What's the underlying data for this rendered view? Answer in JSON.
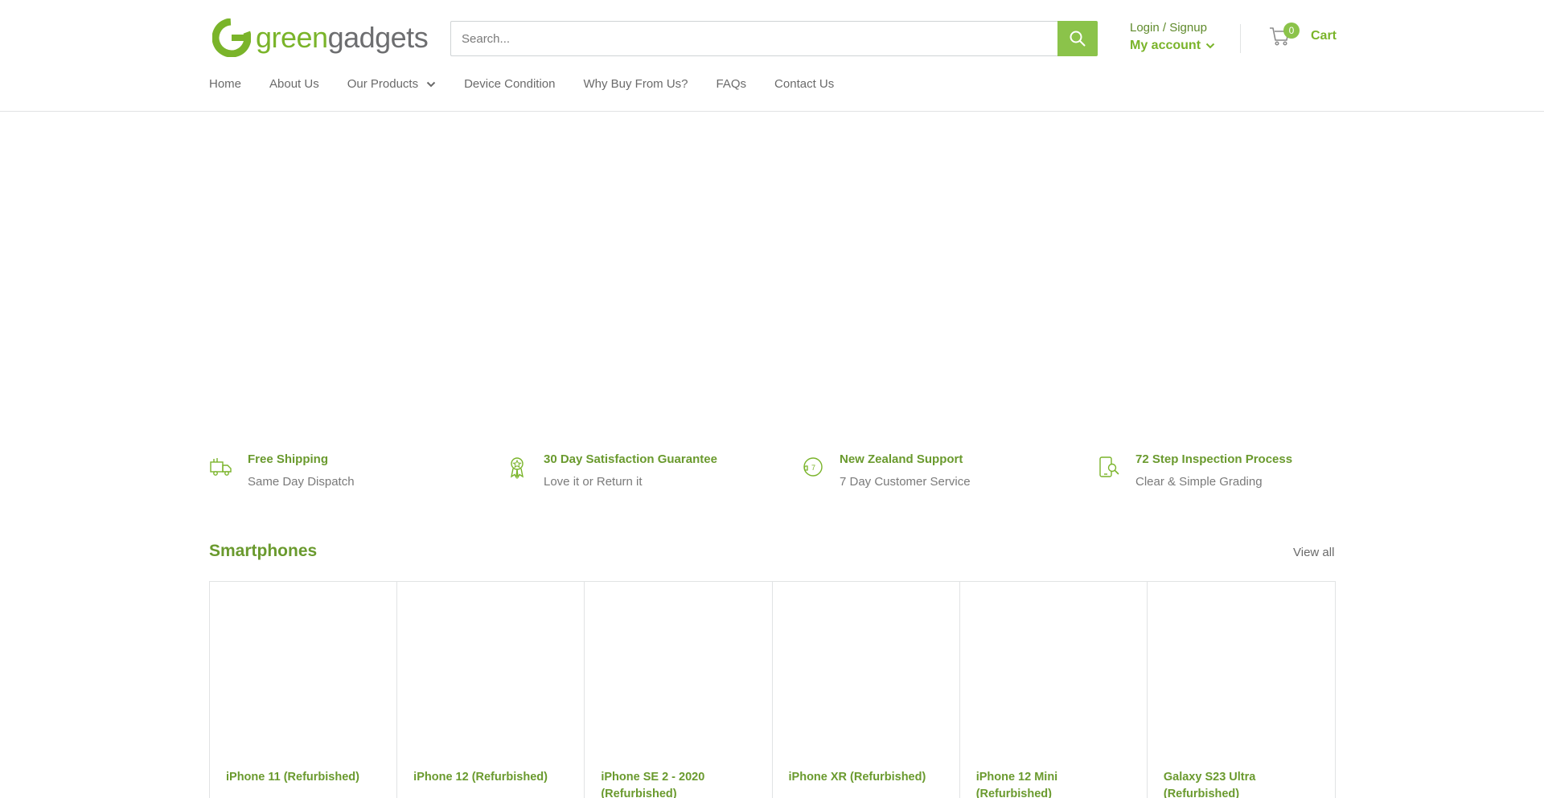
{
  "header": {
    "logo": {
      "part1": "green",
      "part2": "gadgets"
    },
    "search": {
      "placeholder": "Search..."
    },
    "account": {
      "login_label": "Login / Signup",
      "my_account_label": "My account"
    },
    "cart": {
      "count": "0",
      "label": "Cart"
    }
  },
  "nav": {
    "items": [
      {
        "label": "Home"
      },
      {
        "label": "About Us"
      },
      {
        "label": "Our Products"
      },
      {
        "label": "Device Condition"
      },
      {
        "label": "Why Buy From Us?"
      },
      {
        "label": "FAQs"
      },
      {
        "label": "Contact Us"
      }
    ]
  },
  "features": [
    {
      "title": "Free Shipping",
      "subtitle": "Same Day Dispatch",
      "icon": "delivery-truck-icon"
    },
    {
      "title": "30 Day Satisfaction Guarantee",
      "subtitle": "Love it or Return it",
      "icon": "award-ribbon-icon"
    },
    {
      "title": "New Zealand Support",
      "subtitle": "7 Day Customer Service",
      "icon": "support-phone-icon"
    },
    {
      "title": "72 Step Inspection Process",
      "subtitle": "Clear & Simple Grading",
      "icon": "device-inspection-icon"
    }
  ],
  "section": {
    "title": "Smartphones",
    "view_all": "View all",
    "products": [
      {
        "title": "iPhone 11 (Refurbished)"
      },
      {
        "title": "iPhone 12 (Refurbished)"
      },
      {
        "title": "iPhone SE 2 - 2020 (Refurbished)"
      },
      {
        "title": "iPhone XR (Refurbished)"
      },
      {
        "title": "iPhone 12 Mini (Refurbished)"
      },
      {
        "title": "Galaxy S23 Ultra (Refurbished)"
      }
    ]
  },
  "colors": {
    "brand_green": "#7ab42a",
    "dark_green": "#6a9a2e",
    "search_button": "#8bc34a",
    "text_gray": "#6a6a6a"
  }
}
